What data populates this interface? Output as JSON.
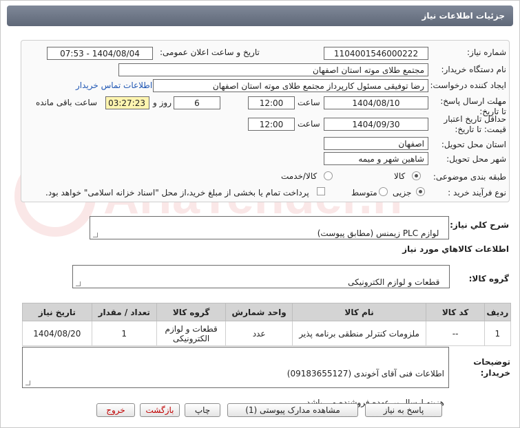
{
  "page_title": "جزئیات اطلاعات نیاز",
  "fields": {
    "need_number_label": "شماره نیاز:",
    "need_number_value": "1104001546000222",
    "announce_label": "تاریخ و ساعت اعلان عمومی:",
    "announce_value": "1404/08/04 - 07:53",
    "buyer_org_label": "نام دستگاه خریدار:",
    "buyer_org_value": "مجتمع طلای موته استان اصفهان",
    "creator_label": "ایجاد کننده درخواست:",
    "creator_value": "رضا توفیقی مسئول کارپرداز مجتمع طلای موته استان اصفهان",
    "contact_link": "اطلاعات تماس خریدار",
    "reply_deadline_label": "مهلت ارسال پاسخ: تا تاریخ:",
    "reply_date": "1404/08/10",
    "time_label": "ساعت",
    "reply_time": "12:00",
    "days_value": "6",
    "days_label": "روز و",
    "remaining_value": "03:27:23",
    "remaining_label": "ساعت باقی مانده",
    "validity_label": "حداقل تاریخ اعتبار قیمت: تا تاریخ:",
    "validity_date": "1404/09/30",
    "validity_time": "12:00",
    "province_label": "استان محل تحویل:",
    "province_value": "اصفهان",
    "city_label": "شهر محل تحویل:",
    "city_value": "شاهین شهر و میمه",
    "category_label": "طبقه بندی موضوعی:",
    "category_opt_goods": "کالا",
    "category_opt_goods_service": "کالا/خدمت",
    "process_label": "نوع فرآیند خرید :",
    "process_opt_partial": "جزیی",
    "process_opt_medium": "متوسط",
    "payment_note": "پرداخت تمام یا بخشی از مبلغ خرید،از محل \"اسناد خزانه اسلامی\" خواهد بود."
  },
  "summary": {
    "label": "شرح کلي نياز:",
    "value": "لوازم PLC زیمنس (مطابق پیوست)"
  },
  "goods_info_title": "اطلاعات کالاهاي مورد نياز",
  "goods_group": {
    "label": "گروه کالا:",
    "value": "قطعات و لوازم الکترونیکی"
  },
  "table": {
    "headers": [
      "ردیف",
      "کد کالا",
      "نام کالا",
      "واحد شمارش",
      "گروه کالا",
      "تعداد / مقدار",
      "تاریخ نیاز"
    ],
    "rows": [
      [
        "1",
        "--",
        "ملزومات کنترلر منطقی برنامه پذیر",
        "عدد",
        "قطعات و لوازم الکترونیکی",
        "1",
        "1404/08/20"
      ]
    ]
  },
  "buyer_notes": {
    "label": "توضیحات خریدار:",
    "line1": "اطلاعات فنی آقای آخوندی (09183655127)",
    "line2": "هزینه ارسال بر عهده فروشنده می باشد."
  },
  "buttons": {
    "reply": "پاسخ به نیاز",
    "attachments": "مشاهده مدارک پیوستی (1)",
    "print": "چاپ",
    "back": "بازگشت",
    "exit": "خروج"
  },
  "watermark_text": "AriaTender.neT",
  "colors": {
    "header_bg": "#6f7888",
    "link": "#1f56b3",
    "remaining_bg": "#fff5b0",
    "exit_text": "#c00000"
  }
}
